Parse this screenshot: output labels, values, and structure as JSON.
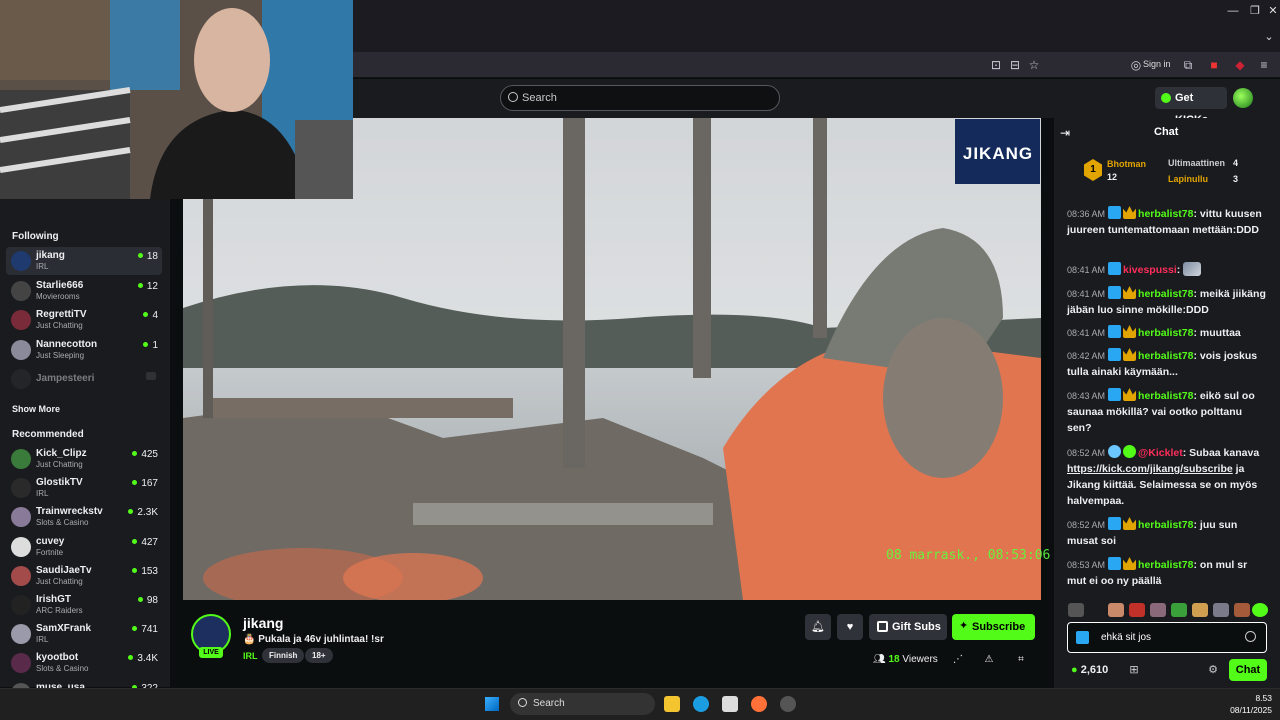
{
  "browser": {
    "signin_label": "Sign in"
  },
  "header": {
    "search_placeholder": "Search",
    "get_kicks_label": "Get KICKs"
  },
  "sidebar": {
    "following_title": "Following",
    "following": [
      {
        "name": "jikang",
        "category": "IRL",
        "viewers": "18",
        "avatar": "#1e3a6e",
        "active": true
      },
      {
        "name": "Starlie666",
        "category": "Movierooms",
        "viewers": "12",
        "avatar": "#444"
      },
      {
        "name": "RegrettiTV",
        "category": "Just Chatting",
        "viewers": "4",
        "avatar": "#7a2b3a"
      },
      {
        "name": "Nannecotton",
        "category": "Just Sleeping",
        "viewers": "1",
        "avatar": "#8a8a9a"
      },
      {
        "name": "Jampesteeri",
        "category": "",
        "viewers": "",
        "avatar": "#333",
        "offline": true
      }
    ],
    "show_more_label": "Show More",
    "recommended_title": "Recommended",
    "recommended": [
      {
        "name": "Kick_Clipz",
        "category": "Just Chatting",
        "viewers": "425",
        "avatar": "#3a7a3a"
      },
      {
        "name": "GlostikTV",
        "category": "IRL",
        "viewers": "167",
        "avatar": "#2a2a2a"
      },
      {
        "name": "Trainwreckstv",
        "category": "Slots & Casino",
        "viewers": "2.3K",
        "avatar": "#8a7a9a"
      },
      {
        "name": "cuvey",
        "category": "Fortnite",
        "viewers": "427",
        "avatar": "#ddd"
      },
      {
        "name": "SaudiJaeTv",
        "category": "Just Chatting",
        "viewers": "153",
        "avatar": "#a34a4a"
      },
      {
        "name": "IrishGT",
        "category": "ARC Raiders",
        "viewers": "98",
        "avatar": "#222"
      },
      {
        "name": "SamXFrank",
        "category": "IRL",
        "viewers": "741",
        "avatar": "#9a9aaa"
      },
      {
        "name": "kyootbot",
        "category": "Slots & Casino",
        "viewers": "3.4K",
        "avatar": "#5a2a4a"
      },
      {
        "name": "muse_usa",
        "category": "",
        "viewers": "322",
        "avatar": "#555"
      }
    ]
  },
  "video": {
    "timestamp_overlay": "08 marrask., 08:53:06",
    "logo_text": "JIKANG"
  },
  "stream": {
    "channel_name": "jikang",
    "live_label": "LIVE",
    "title": "🎂 Pukala ja 46v juhlintaa! !sr",
    "category": "IRL",
    "tags": [
      "Finnish",
      "18+"
    ],
    "gift_subs_label": "Gift Subs",
    "subscribe_label": "Subscribe",
    "viewers_count": "18",
    "viewers_label": "Viewers"
  },
  "chat": {
    "title": "Chat",
    "leaderboard": {
      "rank": "1",
      "first_name": "Bhotman",
      "first_count": "12",
      "second_name": "Ultimaattinen",
      "second_count": "4",
      "third_name": "Lapinullu",
      "third_count": "3"
    },
    "messages": [
      {
        "time": "08:36 AM",
        "user": "herbalist78",
        "text": "vittu kuusen juureen tuntemattomaan mettään:DDD",
        "badges": [
          "blue",
          "gold"
        ]
      },
      {
        "time": "08:41 AM",
        "user": "kivespussi",
        "text": "",
        "badges": [
          "blue"
        ],
        "red": true,
        "emote": true
      },
      {
        "time": "08:41 AM",
        "user": "herbalist78",
        "text": "meikä jiikäng jäbän luo sinne mökille:DDD",
        "badges": [
          "blue",
          "gold"
        ]
      },
      {
        "time": "08:41 AM",
        "user": "herbalist78",
        "text": "muuttaa",
        "badges": [
          "blue",
          "gold"
        ]
      },
      {
        "time": "08:42 AM",
        "user": "herbalist78",
        "text": "vois joskus tulla ainaki käymään...",
        "badges": [
          "blue",
          "gold"
        ]
      },
      {
        "time": "08:43 AM",
        "user": "herbalist78",
        "text": "eikö sul oo saunaa mökillä? vai ootko polttanu sen?",
        "badges": [
          "blue",
          "gold"
        ]
      },
      {
        "time": "08:52 AM",
        "user": "@Kicklet",
        "text_before": "Subaa kanava ",
        "link": "https://kick.com/jikang/subscribe",
        "text_after": " ja Jikang kiittää. Selaimessa se on myös halvempaa.",
        "badges": [
          "bot",
          "ver"
        ],
        "red": true
      },
      {
        "time": "08:52 AM",
        "user": "herbalist78",
        "text": "juu sun musat soi",
        "badges": [
          "blue",
          "gold"
        ]
      },
      {
        "time": "08:53 AM",
        "user": "herbalist78",
        "text": "on mul sr mut ei oo ny päällä",
        "badges": [
          "blue",
          "gold"
        ]
      }
    ],
    "input_value": "ehkä sit jos",
    "points": "2,610",
    "send_label": "Chat"
  },
  "taskbar": {
    "search_label": "Search",
    "time": "8.53",
    "date": "08/11/2025"
  }
}
